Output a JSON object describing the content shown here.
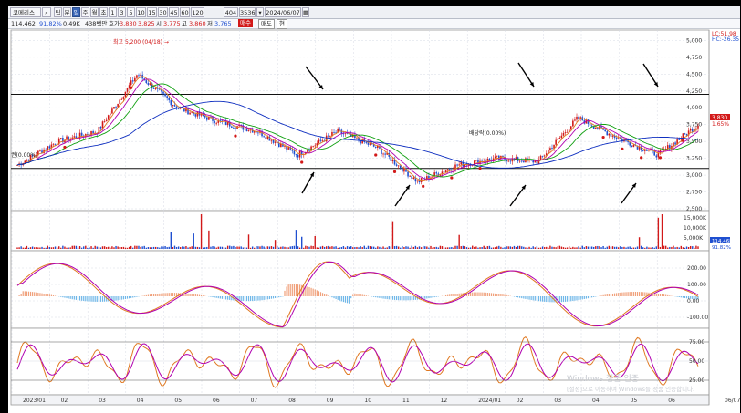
{
  "toolbar": {
    "stock_name": "코메리스",
    "buttons": [
      "틱",
      "분",
      "일",
      "주",
      "월",
      "초",
      "1",
      "3",
      "5",
      "10",
      "15",
      "30",
      "45",
      "60",
      "120"
    ],
    "selected": "일",
    "count": "404",
    "total": "3536",
    "date": "2024/06/07"
  },
  "infobar": {
    "price": "114,462",
    "ratio": "91.82%",
    "volume": "0.49K",
    "quote": "438백만",
    "label_ho": "호가",
    "open_label": "시",
    "high_label": "고",
    "low_label": "저",
    "prices": [
      "3,830",
      "3,825",
      "3,775",
      "3,860",
      "3,765"
    ],
    "btn_buy": "매수",
    "btn_sell": "매도",
    "btn_more": "현"
  },
  "price_axis": [
    "5,000",
    "4,750",
    "4,500",
    "4,250",
    "4,000",
    "3,750",
    "3,500",
    "3,250",
    "3,000",
    "2,750",
    "2,500"
  ],
  "price_legend": [
    "LC:51.98",
    "HC:-26.35"
  ],
  "current_price": "3,830",
  "current_pct": "1.65%",
  "annotations": {
    "high": "최고 5,200 (04/18) →",
    "left_label": "권(0.00%)",
    "mid_label": "배당락(0.00%)"
  },
  "volume_axis": [
    "15,000K",
    "10,000K",
    "5,000K"
  ],
  "volume_current": "114.46K",
  "volume_ratio": "91.82%",
  "macd_axis": [
    "200.00",
    "100.00",
    "0.00",
    "-100.00"
  ],
  "stoch_axis": [
    "75.00",
    "50.00",
    "25.00"
  ],
  "x_axis": [
    "2023/01",
    "02",
    "03",
    "04",
    "05",
    "06",
    "07",
    "08",
    "09",
    "10",
    "11",
    "12",
    "2024/01",
    "02",
    "03",
    "04",
    "05",
    "06",
    "06/07"
  ],
  "watermark": [
    "Windows 정품 인증",
    "[설정]으로 이동하여 Windows를 정품 인증합니다."
  ],
  "colors": {
    "up": "#d21919",
    "down": "#1f4fd0",
    "ma5": "#e07820",
    "ma10": "#b000b0",
    "ma20": "#11a011",
    "ma60": "#1030c0",
    "signal_arrow": "#000000"
  },
  "chart_data": {
    "type": "line",
    "x": [
      "2023/01",
      "2023/02",
      "2023/03",
      "2023/04",
      "2023/05",
      "2023/06",
      "2023/07",
      "2023/08",
      "2023/09",
      "2023/10",
      "2023/11",
      "2023/12",
      "2024/01",
      "2024/02",
      "2024/03",
      "2024/04",
      "2024/05",
      "2024/06"
    ],
    "ylim": [
      2500,
      5100
    ],
    "resistance": 4200,
    "support": 3100,
    "series": [
      {
        "values": [
          3150,
          3500,
          3650,
          4500,
          4000,
          3800,
          3650,
          3300,
          3650,
          3400,
          2900,
          3150,
          3250,
          3200,
          3850,
          3550,
          3300,
          3750
        ]
      }
    ]
  }
}
